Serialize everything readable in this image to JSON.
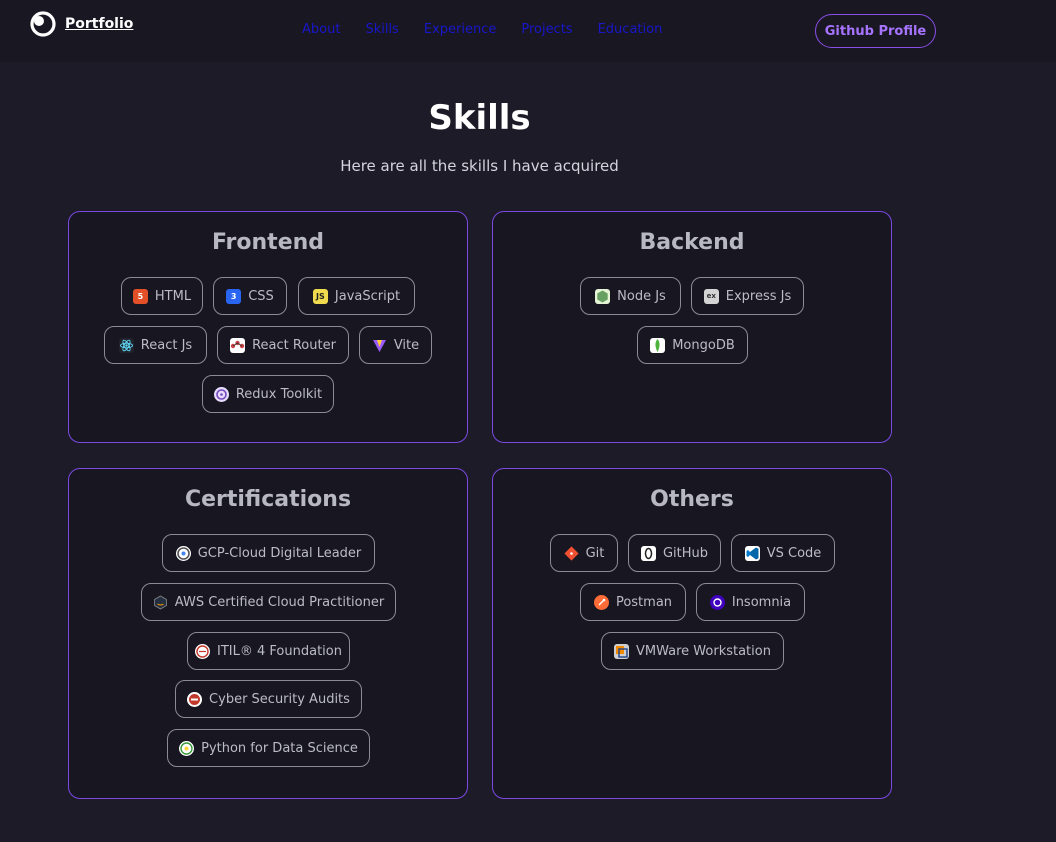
{
  "nav": {
    "brand": "Portfolio",
    "links": [
      "About",
      "Skills",
      "Experience",
      "Projects",
      "Education"
    ],
    "github_button": "Github Profile"
  },
  "skills": {
    "title": "Skills",
    "subtitle": "Here are all the skills I have acquired",
    "frontend": {
      "title": "Frontend",
      "items": [
        "HTML",
        "CSS",
        "JavaScript",
        "React Js",
        "React Router",
        "Vite",
        "Redux Toolkit"
      ]
    },
    "backend": {
      "title": "Backend",
      "items": [
        "Node Js",
        "Express Js",
        "MongoDB"
      ]
    },
    "certifications": {
      "title": "Certifications",
      "items": [
        "GCP-Cloud Digital Leader",
        "AWS Certified Cloud Practitioner",
        "ITIL® 4 Foundation",
        "Cyber Security Audits",
        "Python for Data Science"
      ]
    },
    "others": {
      "title": "Others",
      "items": [
        "Git",
        "GitHub",
        "VS Code",
        "Postman",
        "Insomnia",
        "VMWare Workstation"
      ]
    }
  },
  "icons": {
    "html": "html5-icon",
    "css": "css3-icon",
    "javascript": "javascript-icon",
    "react": "react-icon",
    "react_router": "react-router-icon",
    "vite": "vite-icon",
    "redux": "redux-icon",
    "node": "nodejs-icon",
    "express": "express-icon",
    "mongodb": "mongodb-icon",
    "gcp": "gcp-badge-icon",
    "aws": "aws-badge-icon",
    "itil": "itil-badge-icon",
    "cyber": "cyber-security-badge-icon",
    "python": "python-badge-icon",
    "git": "git-icon",
    "github": "github-icon",
    "vscode": "vscode-icon",
    "postman": "postman-icon",
    "insomnia": "insomnia-icon",
    "vmware": "vmware-icon"
  },
  "colors": {
    "background": "#1c1b27",
    "card_border": "#7c4ae0",
    "accent": "#a774ff",
    "nav_link": "#1a17c9"
  }
}
